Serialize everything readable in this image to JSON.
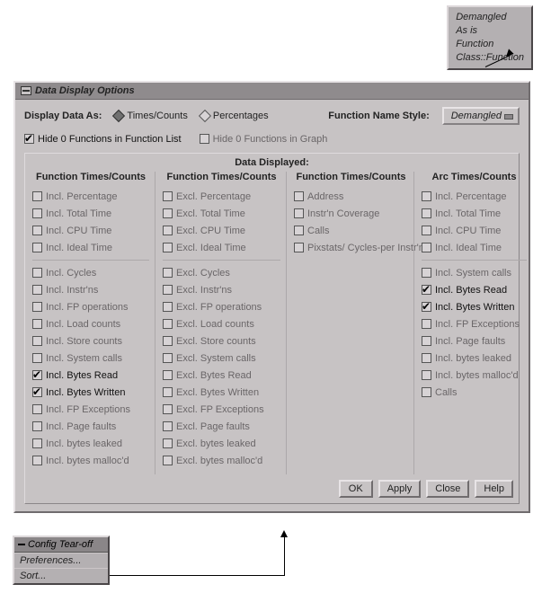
{
  "popup": {
    "items": [
      "Demangled",
      "As is",
      "Function",
      "Class::Function"
    ]
  },
  "tearoff": {
    "title": "Config Tear-off",
    "items": [
      "Preferences...",
      "Sort..."
    ]
  },
  "window": {
    "title": "Data Display Options",
    "display_as_label": "Display Data As:",
    "display_as_options": [
      "Times/Counts",
      "Percentages"
    ],
    "display_as_selected": 0,
    "fn_style_label": "Function Name Style:",
    "fn_style_value": "Demangled",
    "hide_list_label": "Hide 0 Functions in Function List",
    "hide_list_checked": true,
    "hide_graph_label": "Hide 0 Functions in Graph",
    "hide_graph_checked": false,
    "panel_title": "Data Displayed:",
    "col1_header": "Function Times/Counts",
    "col2_header": "Function Times/Counts",
    "col3_header": "Function Times/Counts",
    "col4_header": "Arc Times/Counts",
    "col1_top": [
      {
        "label": "Incl. Percentage",
        "ck": false
      },
      {
        "label": "Incl. Total Time",
        "ck": false
      },
      {
        "label": "Incl. CPU Time",
        "ck": false
      },
      {
        "label": "Incl. Ideal Time",
        "ck": false
      }
    ],
    "col1_bot": [
      {
        "label": "Incl. Cycles",
        "ck": false
      },
      {
        "label": "Incl. Instr'ns",
        "ck": false
      },
      {
        "label": "Incl. FP operations",
        "ck": false
      },
      {
        "label": "Incl. Load counts",
        "ck": false
      },
      {
        "label": "Incl. Store counts",
        "ck": false
      },
      {
        "label": "Incl. System calls",
        "ck": false
      },
      {
        "label": "Incl. Bytes Read",
        "ck": true
      },
      {
        "label": "Incl. Bytes Written",
        "ck": true
      },
      {
        "label": "Incl. FP Exceptions",
        "ck": false
      },
      {
        "label": "Incl. Page faults",
        "ck": false
      },
      {
        "label": "Incl. bytes leaked",
        "ck": false
      },
      {
        "label": "Incl. bytes malloc'd",
        "ck": false
      }
    ],
    "col2_top": [
      {
        "label": "Excl. Percentage",
        "ck": false
      },
      {
        "label": "Excl. Total Time",
        "ck": false
      },
      {
        "label": "Excl. CPU Time",
        "ck": false
      },
      {
        "label": "Excl. Ideal Time",
        "ck": false
      }
    ],
    "col2_bot": [
      {
        "label": "Excl. Cycles",
        "ck": false
      },
      {
        "label": "Excl. Instr'ns",
        "ck": false
      },
      {
        "label": "Excl. FP operations",
        "ck": false
      },
      {
        "label": "Excl. Load counts",
        "ck": false
      },
      {
        "label": "Excl. Store counts",
        "ck": false
      },
      {
        "label": "Excl. System calls",
        "ck": false
      },
      {
        "label": "Excl. Bytes Read",
        "ck": false
      },
      {
        "label": "Excl. Bytes Written",
        "ck": false
      },
      {
        "label": "Excl. FP Exceptions",
        "ck": false
      },
      {
        "label": "Excl. Page faults",
        "ck": false
      },
      {
        "label": "Excl. bytes leaked",
        "ck": false
      },
      {
        "label": "Excl. bytes malloc'd",
        "ck": false
      }
    ],
    "col3": [
      {
        "label": "Address",
        "ck": false
      },
      {
        "label": "Instr'n Coverage",
        "ck": false
      },
      {
        "label": "Calls",
        "ck": false
      },
      {
        "label": "Pixstats/ Cycles-per Instr'n",
        "ck": false
      }
    ],
    "col4_top": [
      {
        "label": "Incl. Percentage",
        "ck": false
      },
      {
        "label": "Incl. Total Time",
        "ck": false
      },
      {
        "label": "Incl. CPU Time",
        "ck": false
      },
      {
        "label": "Incl. Ideal Time",
        "ck": false
      }
    ],
    "col4_bot": [
      {
        "label": "Incl. System calls",
        "ck": false
      },
      {
        "label": "Incl. Bytes Read",
        "ck": true
      },
      {
        "label": "Incl. Bytes Written",
        "ck": true
      },
      {
        "label": "Incl. FP Exceptions",
        "ck": false
      },
      {
        "label": "Incl. Page faults",
        "ck": false
      },
      {
        "label": "Incl. bytes leaked",
        "ck": false
      },
      {
        "label": "Incl. bytes malloc'd",
        "ck": false
      },
      {
        "label": "Calls",
        "ck": false
      }
    ],
    "buttons": [
      "OK",
      "Apply",
      "Close",
      "Help"
    ]
  }
}
